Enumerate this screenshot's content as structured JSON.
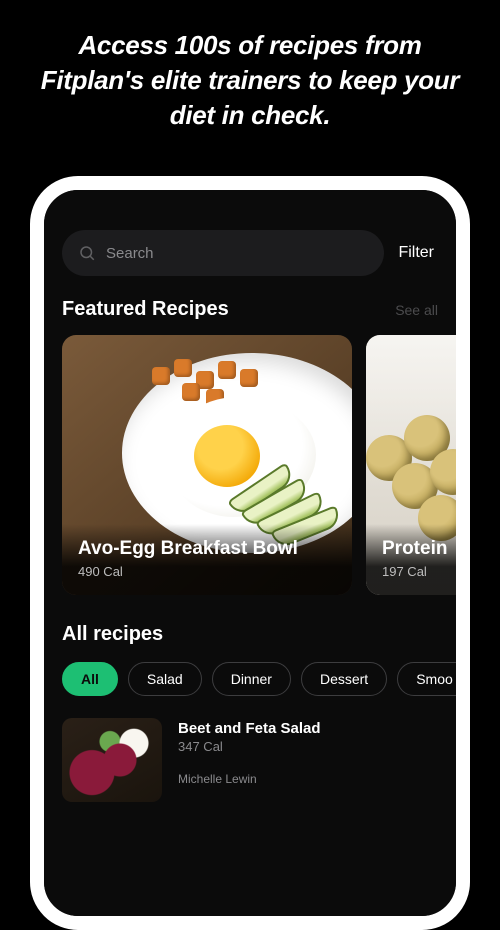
{
  "headline": "Access 100s of recipes from Fitplan's elite trainers to keep your diet in check.",
  "search": {
    "placeholder": "Search"
  },
  "filter_label": "Filter",
  "featured": {
    "title": "Featured Recipes",
    "see_all": "See all",
    "items": [
      {
        "title": "Avo-Egg Breakfast Bowl",
        "calories": "490 Cal"
      },
      {
        "title": "Protein",
        "calories": "197 Cal"
      }
    ]
  },
  "all": {
    "title": "All recipes",
    "chips": [
      "All",
      "Salad",
      "Dinner",
      "Dessert",
      "Smoo"
    ],
    "active_chip": "All",
    "items": [
      {
        "title": "Beet and Feta Salad",
        "calories": "347 Cal",
        "author": "Michelle Lewin"
      }
    ]
  }
}
